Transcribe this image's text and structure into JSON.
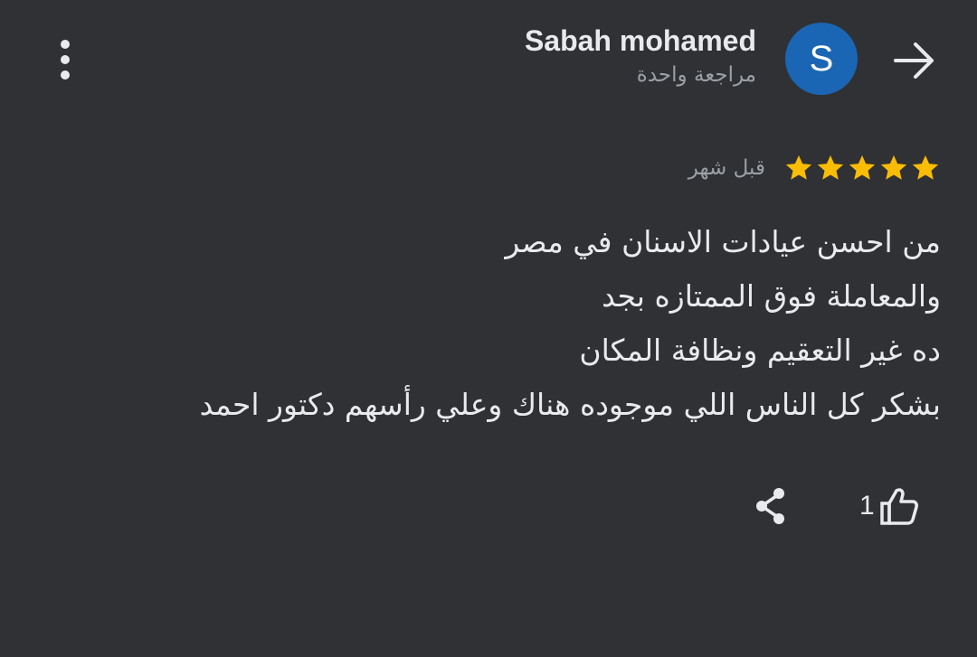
{
  "header": {
    "back_icon": "arrow-forward-icon",
    "menu_icon": "more-vert-icon"
  },
  "user": {
    "name": "Sabah mohamed",
    "reviews_count_text": "مراجعة واحدة",
    "avatar_letter": "S",
    "avatar_color": "#1a66b4"
  },
  "review": {
    "rating": 5,
    "max_rating": 5,
    "star_color": "#fbbc04",
    "time_text": "قبل شهر",
    "lines": [
      "من احسن عيادات الاسنان في مصر",
      "والمعاملة فوق الممتازه بجد",
      "ده غير التعقيم ونظافة المكان",
      "بشكر كل الناس اللي موجوده هناك وعلي رأسهم دكتور احمد"
    ]
  },
  "actions": {
    "like_count": "1",
    "like_icon": "thumb-up-icon",
    "share_icon": "share-icon"
  }
}
